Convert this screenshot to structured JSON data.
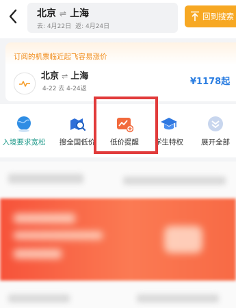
{
  "header": {
    "from": "北京",
    "separator": "⇌",
    "to": "上海",
    "depart_label": "去: 4月22日",
    "return_label": "返: 4月24日",
    "back_to_search": "回到搜索"
  },
  "subscription": {
    "title": "订阅的机票临近起飞容易涨价",
    "from": "北京",
    "separator": "⇌",
    "to": "上海",
    "dates": "4-22 去 4-24返",
    "price": "¥1178起"
  },
  "shortcuts": [
    {
      "label": "入境要求宽松",
      "icon": "globe-icon"
    },
    {
      "label": "搜全国低价",
      "icon": "map-search-icon"
    },
    {
      "label": "低价提醒",
      "icon": "price-alert-icon"
    },
    {
      "label": "学生特权",
      "icon": "graduation-cap-icon"
    },
    {
      "label": "展开全部",
      "icon": "expand-chevron-icon"
    }
  ],
  "colors": {
    "accent_orange": "#f7a823",
    "price_blue": "#2a7de1",
    "highlight_red": "#e13b3b"
  }
}
